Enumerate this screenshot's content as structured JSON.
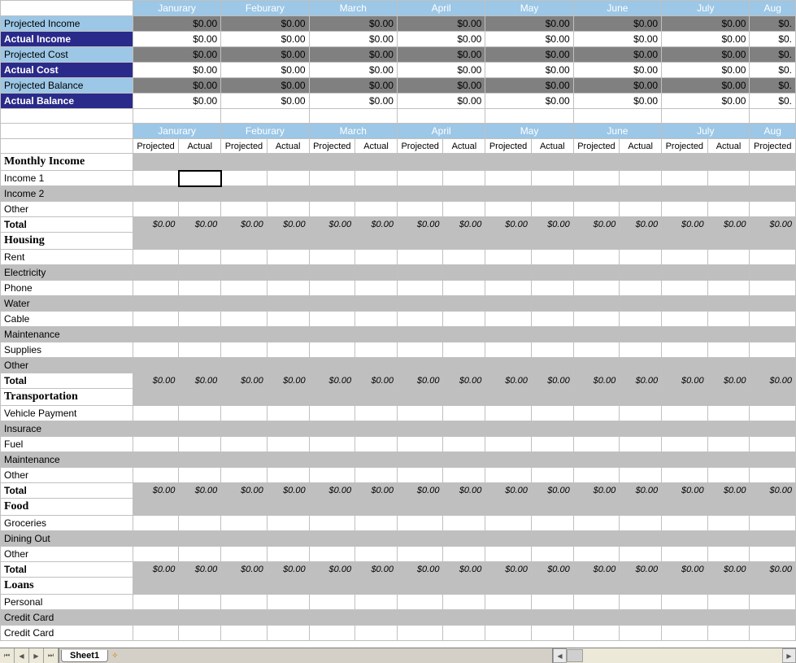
{
  "months": [
    "Janurary",
    "Feburary",
    "March",
    "April",
    "May",
    "June",
    "July",
    "Aug"
  ],
  "summaryRows": [
    {
      "label": "Projected Income",
      "style": "light",
      "valStyle": "gray"
    },
    {
      "label": "Actual Income",
      "style": "dark",
      "valStyle": "white"
    },
    {
      "label": "Projected Cost",
      "style": "light",
      "valStyle": "gray"
    },
    {
      "label": "Actual Cost",
      "style": "dark",
      "valStyle": "white"
    },
    {
      "label": "Projected Balance",
      "style": "light",
      "valStyle": "gray"
    },
    {
      "label": "Actual Balance",
      "style": "dark",
      "valStyle": "white"
    }
  ],
  "zero": "$0.00",
  "zeroCut": "$0.",
  "subHeaders": [
    "Projected",
    "Actual"
  ],
  "sections": [
    {
      "title": "Monthly Income",
      "items": [
        "Income 1",
        "Income 2",
        "Other"
      ],
      "hasTotal": true
    },
    {
      "title": "Housing",
      "items": [
        "Rent",
        "Electricity",
        "Phone",
        "Water",
        "Cable",
        "Maintenance",
        "Supplies",
        "Other"
      ],
      "hasTotal": true
    },
    {
      "title": "Transportation",
      "items": [
        "Vehicle Payment",
        "Insurace",
        "Fuel",
        "Maintenance",
        "Other"
      ],
      "hasTotal": true
    },
    {
      "title": "Food",
      "items": [
        "Groceries",
        "Dining Out",
        "Other"
      ],
      "hasTotal": true
    },
    {
      "title": "Loans",
      "items": [
        "Personal",
        "Credit Card",
        "Credit Card"
      ],
      "hasTotal": false
    }
  ],
  "totalLabel": "Total",
  "sheetTab": "Sheet1",
  "activeCell": {
    "section": 0,
    "item": 0,
    "col": 1
  }
}
